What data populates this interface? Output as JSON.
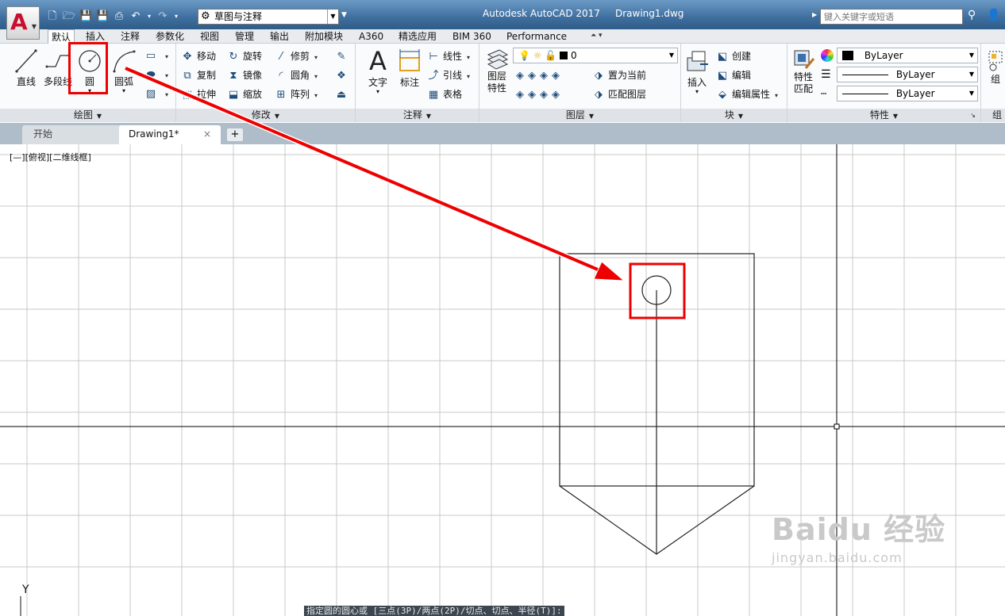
{
  "titlebar": {
    "title": "Autodesk AutoCAD 2017",
    "document": "Drawing1.dwg",
    "workspace": "草图与注释",
    "search_placeholder": "键入关键字或短语",
    "app_letter": "A"
  },
  "ribbon_tabs": [
    "默认",
    "插入",
    "注释",
    "参数化",
    "视图",
    "管理",
    "输出",
    "附加模块",
    "A360",
    "精选应用",
    "BIM 360",
    "Performance"
  ],
  "draw_panel": {
    "title": "绘图",
    "line": "直线",
    "polyline": "多段线",
    "circle": "圆",
    "arc": "圆弧"
  },
  "modify_panel": {
    "title": "修改",
    "move": "移动",
    "rotate": "旋转",
    "trim": "修剪",
    "copy": "复制",
    "mirror": "镜像",
    "fillet": "圆角",
    "stretch": "拉伸",
    "scale": "缩放",
    "array": "阵列"
  },
  "annotation_panel": {
    "title": "注释",
    "text": "文字",
    "dimension": "标注",
    "linear": "线性",
    "leader": "引线",
    "table": "表格"
  },
  "layers_panel": {
    "title": "图层",
    "layer_properties": "图层特性",
    "current_layer": "0",
    "set_current": "置为当前",
    "match_layer": "匹配图层"
  },
  "block_panel": {
    "title": "块",
    "insert": "插入",
    "create": "创建",
    "edit": "编辑",
    "edit_attributes": "编辑属性"
  },
  "properties_panel": {
    "title": "特性",
    "match_properties": "特性匹配",
    "color": "ByLayer",
    "linetype": "ByLayer",
    "lineweight": "ByLayer"
  },
  "group_panel": {
    "label": "组",
    "title": "组"
  },
  "doc_tabs": {
    "start": "开始",
    "drawing": "Drawing1*",
    "close": "×",
    "add": "+"
  },
  "viewport": {
    "label": "[—][俯视][二维线框]",
    "command_prompt": "指定圆的圆心或 [三点(3P)/两点(2P)/切点、切点、半径(T)]:",
    "ucs_y": "Y"
  },
  "watermark": {
    "brand": "Baidu 经验",
    "url": "jingyan.baidu.com"
  },
  "colors": {
    "highlight_red": "#e00000",
    "title_blue": "#3f6f9f",
    "grid_gray": "#c8c8c8"
  }
}
